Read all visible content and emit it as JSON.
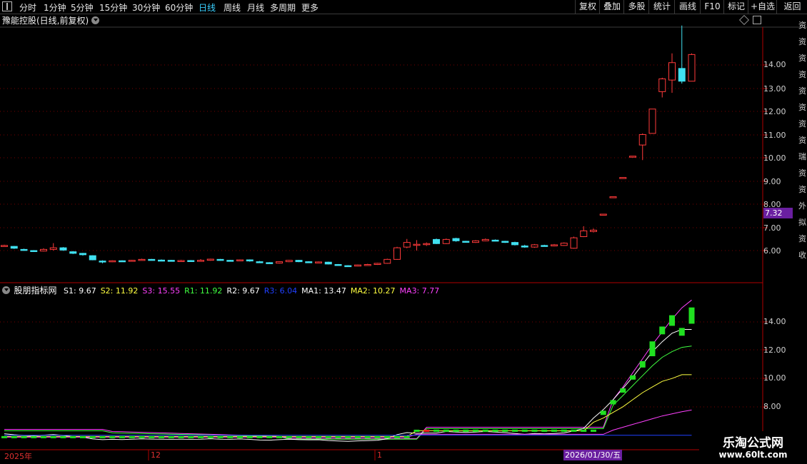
{
  "toolbar": {
    "periods": [
      "分时",
      "1分钟",
      "5分钟",
      "15分钟",
      "30分钟",
      "60分钟",
      "日线",
      "周线",
      "月线",
      "多周期",
      "更多"
    ],
    "active_period": "日线",
    "right_buttons": [
      "复权",
      "叠加",
      "多股",
      "统计",
      "画线",
      "F10",
      "标记",
      "+自选",
      "返回"
    ]
  },
  "title": {
    "name": "豫能控股(日线,前复权)"
  },
  "price_axis": {
    "labels": [
      "14.00",
      "13.00",
      "12.00",
      "11.00",
      "10.00",
      "9.00",
      "8.00",
      "7.00",
      "6.00"
    ],
    "current": "7.32"
  },
  "indicator": {
    "name": "股朋指标网",
    "values": [
      {
        "label": "S1: 9.67",
        "color": "#ffffff"
      },
      {
        "label": "S2: 11.92",
        "color": "#ffff40"
      },
      {
        "label": "S3: 15.55",
        "color": "#ff40ff"
      },
      {
        "label": "R1: 11.92",
        "color": "#40ff40"
      },
      {
        "label": "R2: 9.67",
        "color": "#ffffff"
      },
      {
        "label": "R3: 6.04",
        "color": "#2040ff"
      },
      {
        "label": "MA1: 13.47",
        "color": "#ffffff"
      },
      {
        "label": "MA2: 10.27",
        "color": "#ffff40"
      },
      {
        "label": "MA3: 7.77",
        "color": "#ff40ff"
      }
    ],
    "axis_labels": [
      "14.00",
      "12.00",
      "10.00",
      "8.00"
    ]
  },
  "time_axis": {
    "labels": [
      "2025年",
      "12",
      "1"
    ],
    "cursor_date": "2026/01/30/五"
  },
  "watermark": {
    "title": "乐淘公式网",
    "url": "www.60lt.com"
  },
  "right_strip": [
    "资",
    "资",
    "资",
    "资",
    "资",
    "资",
    "资",
    "资",
    "瑞",
    "资",
    "资",
    "外",
    "拟",
    "资",
    "收"
  ],
  "colors": {
    "up": "#ff3a3a",
    "down": "#40e0f0",
    "grid": "#7a0000",
    "highlight": "#6a1fa0"
  }
}
